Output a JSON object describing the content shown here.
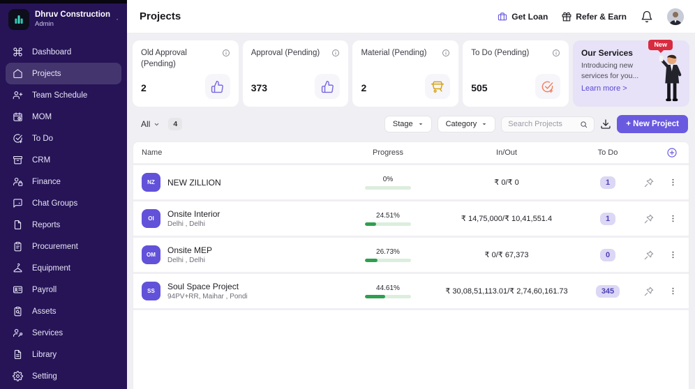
{
  "colors": {
    "sidebar_bg": "#261457",
    "accent_purple": "#6a5ae0",
    "progress_green": "#2f9e4f",
    "todo_badge_bg": "#dcd7f4",
    "todo_badge_text": "#4a3fb5",
    "material_gold": "#d7a414",
    "todo_stat_coral": "#ef7e5e",
    "services_bg": "#e7e2f7",
    "new_badge_red": "#d92b3f",
    "logo_teal": "#2fc7ae"
  },
  "brand": {
    "name": "Dhruv Construction",
    "role": "Admin"
  },
  "sidebar": {
    "items": [
      {
        "label": "Dashboard"
      },
      {
        "label": "Projects"
      },
      {
        "label": "Team Schedule"
      },
      {
        "label": "MOM"
      },
      {
        "label": "To Do"
      },
      {
        "label": "CRM"
      },
      {
        "label": "Finance"
      },
      {
        "label": "Chat Groups"
      },
      {
        "label": "Reports"
      },
      {
        "label": "Procurement"
      },
      {
        "label": "Equipment"
      },
      {
        "label": "Payroll"
      },
      {
        "label": "Assets"
      },
      {
        "label": "Services"
      },
      {
        "label": "Library"
      },
      {
        "label": "Setting"
      }
    ]
  },
  "header": {
    "title": "Projects",
    "get_loan": "Get Loan",
    "refer_earn": "Refer & Earn"
  },
  "stats": [
    {
      "title": "Old Approval (Pending)",
      "value": "2"
    },
    {
      "title": "Approval (Pending)",
      "value": "373"
    },
    {
      "title": "Material (Pending)",
      "value": "2"
    },
    {
      "title": "To Do (Pending)",
      "value": "505"
    }
  ],
  "services": {
    "badge": "New",
    "title": "Our Services",
    "desc_line1": "Introducing new",
    "desc_line2": "services for you...",
    "link": "Learn more >"
  },
  "filters": {
    "all": "All",
    "all_count": "4",
    "stage": "Stage",
    "category": "Category",
    "search_placeholder": "Search Projects",
    "new_project": "+ New Project"
  },
  "table": {
    "columns": {
      "name": "Name",
      "progress": "Progress",
      "inout": "In/Out",
      "todo": "To Do"
    },
    "rows": [
      {
        "initials": "NZ",
        "name": "NEW ZILLION",
        "location": "",
        "progress_label": "0%",
        "progress_pct": 0,
        "inout": "₹ 0/₹ 0",
        "todo": "1"
      },
      {
        "initials": "OI",
        "name": "Onsite Interior",
        "location": "Delhi , Delhi",
        "progress_label": "24.51%",
        "progress_pct": 24.51,
        "inout": "₹ 14,75,000/₹ 10,41,551.4",
        "todo": "1"
      },
      {
        "initials": "OM",
        "name": "Onsite MEP",
        "location": "Delhi , Delhi",
        "progress_label": "26.73%",
        "progress_pct": 26.73,
        "inout": "₹ 0/₹ 67,373",
        "todo": "0"
      },
      {
        "initials": "SS",
        "name": "Soul Space Project",
        "location": "94PV+RR, Maihar , Pondi",
        "progress_label": "44.61%",
        "progress_pct": 44.61,
        "inout": "₹ 30,08,51,113.01/₹ 2,74,60,161.73",
        "todo": "345"
      }
    ]
  }
}
